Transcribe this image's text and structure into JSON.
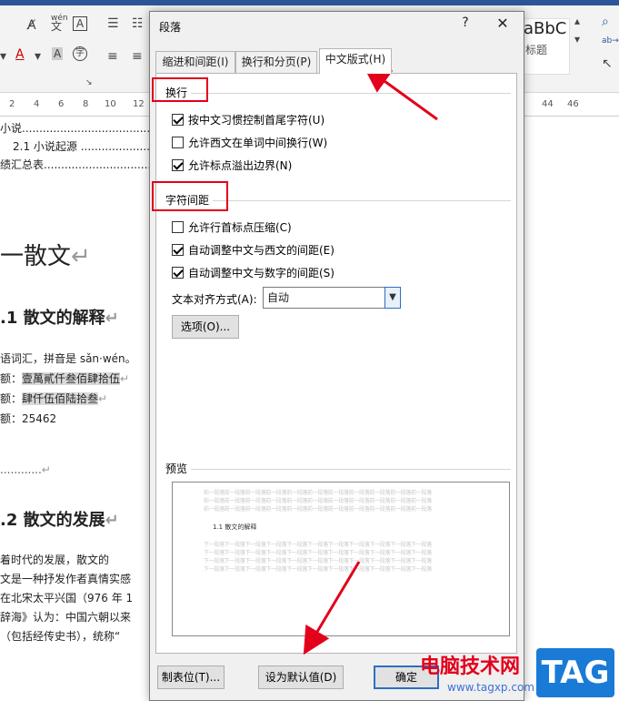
{
  "ribbon": {
    "styles_preview": "aBbC",
    "styles_label": "标题",
    "font_sample_pinyin": "wén",
    "font_sample_char": "文"
  },
  "ruler": {
    "ticks": [
      "2",
      "4",
      "6",
      "8",
      "10",
      "12",
      "44",
      "46"
    ]
  },
  "document": {
    "toc_1": "小说..........................................",
    "toc_2": "2.1 小说起源 .................................",
    "toc_3": "绩汇总表................................................",
    "heading_1": "一散文",
    "heading_1_1": ".1 散文的解释",
    "line_1": "语词汇，拼音是 sǎn·wén。",
    "line_2_prefix": "额：",
    "line_2_value": "壹萬貳仟叁佰肆拾伍",
    "line_3_prefix": "额：",
    "line_3_value": "肆仟伍佰陆拾叁",
    "line_4": "额：25462",
    "dots": "............",
    "heading_1_2": ".2 散文的发展",
    "para_1": "着时代的发展，散文的",
    "para_2": "文是一种抒发作者真情实感",
    "para_3": "在北宋太平兴国（976 年 1",
    "para_4": "辞海》认为：中国六朝以来",
    "para_5": "（包括经传史书），统称“"
  },
  "dialog": {
    "title": "段落",
    "help": "?",
    "close": "✕",
    "tabs": [
      {
        "label": "缩进和间距(I)"
      },
      {
        "label": "换行和分页(P)"
      },
      {
        "label": "中文版式(H)"
      }
    ],
    "line_break": {
      "title": "换行",
      "options": [
        {
          "label": "按中文习惯控制首尾字符(U)",
          "checked": true
        },
        {
          "label": "允许西文在单词中间换行(W)",
          "checked": false
        },
        {
          "label": "允许标点溢出边界(N)",
          "checked": true
        }
      ]
    },
    "char_spacing": {
      "title": "字符间距",
      "options": [
        {
          "label": "允许行首标点压缩(C)",
          "checked": false
        },
        {
          "label": "自动调整中文与西文的间距(E)",
          "checked": true
        },
        {
          "label": "自动调整中文与数字的间距(S)",
          "checked": true
        }
      ],
      "text_align_label": "文本对齐方式(A):",
      "text_align_value": "自动",
      "options_button": "选项(O)..."
    },
    "preview": {
      "title": "预览",
      "before_text": "前一段落前一段落前一段落前一段落前一段落前一段落前一段落前一段落前一段落前一段落前一段落",
      "sample_text": "1.1 散文的解释",
      "after_text": "下一段落下一段落下一段落下一段落下一段落下一段落下一段落下一段落下一段落下一段落下一段落"
    },
    "buttons": {
      "tabs": "制表位(T)...",
      "set_default": "设为默认值(D)",
      "ok": "确定"
    }
  },
  "watermark": {
    "site_name": "电脑技术网",
    "url": "www.tagxp.com",
    "tag": "TAG"
  },
  "colors": {
    "annotation_red": "#e3001b",
    "heading_blue": "#4a90d9",
    "accent_blue": "#2e6fc2"
  }
}
